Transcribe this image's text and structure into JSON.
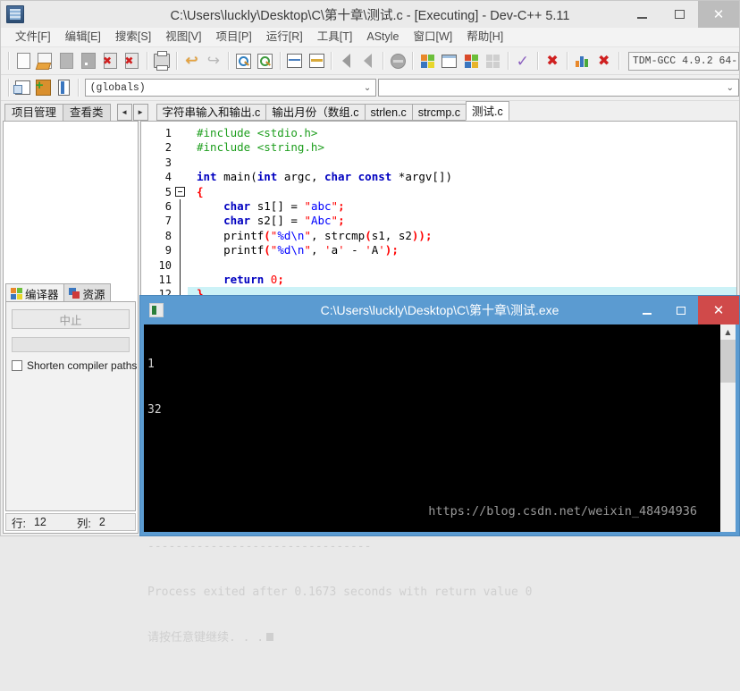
{
  "ide": {
    "title": "C:\\Users\\luckly\\Desktop\\C\\第十章\\测试.c - [Executing] - Dev-C++ 5.11",
    "window_controls": {
      "minimize": "–",
      "maximize": "□",
      "close": "✕"
    },
    "menu": [
      {
        "label": "文件[F]"
      },
      {
        "label": "编辑[E]"
      },
      {
        "label": "搜索[S]"
      },
      {
        "label": "视图[V]"
      },
      {
        "label": "项目[P]"
      },
      {
        "label": "运行[R]"
      },
      {
        "label": "工具[T]"
      },
      {
        "label": "AStyle"
      },
      {
        "label": "窗口[W]"
      },
      {
        "label": "帮助[H]"
      }
    ],
    "compiler_combo": "TDM-GCC 4.9.2 64-",
    "scope_combo": "(globals)",
    "scope_combo2": "",
    "left_tabs": [
      {
        "label": "项目管理",
        "active": true
      },
      {
        "label": "查看类",
        "active": false
      }
    ],
    "nav_buttons": {
      "prev": "◄",
      "next": "►"
    },
    "editor_tabs": [
      {
        "label": "字符串输入和输出.c",
        "active": false
      },
      {
        "label": "输出月份（数组.c",
        "active": false
      },
      {
        "label": "strlen.c",
        "active": false
      },
      {
        "label": "strcmp.c",
        "active": false
      },
      {
        "label": "测试.c",
        "active": true
      }
    ],
    "bottom_tabs": [
      {
        "label": "编译器",
        "active": true
      },
      {
        "label": "资源",
        "active": false
      }
    ],
    "abort_button": "中止",
    "shorten_paths_label": "Shorten compiler paths",
    "status": {
      "row_label": "行:",
      "row_value": "12",
      "col_label": "列:",
      "col_value": "2"
    }
  },
  "code": {
    "lines": [
      {
        "num": "1",
        "text": "#include <stdio.h>"
      },
      {
        "num": "2",
        "text": "#include <string.h>"
      },
      {
        "num": "3",
        "text": ""
      },
      {
        "num": "4",
        "text": "int main(int argc, char const *argv[])"
      },
      {
        "num": "5",
        "text": "{"
      },
      {
        "num": "6",
        "text": "    char s1[] = \"abc\";"
      },
      {
        "num": "7",
        "text": "    char s2[] = \"Abc\";"
      },
      {
        "num": "8",
        "text": "    printf(\"%d\\n\", strcmp(s1, s2));"
      },
      {
        "num": "9",
        "text": "    printf(\"%d\\n\", 'a' - 'A');"
      },
      {
        "num": "10",
        "text": ""
      },
      {
        "num": "11",
        "text": "    return 0;"
      },
      {
        "num": "12",
        "text": "}"
      }
    ]
  },
  "console": {
    "title": "C:\\Users\\luckly\\Desktop\\C\\第十章\\测试.exe",
    "window_controls": {
      "minimize": "–",
      "maximize": "□",
      "close": "✕"
    },
    "output_lines": [
      "1",
      "32",
      "",
      "",
      "--------------------------------",
      "Process exited after 0.1673 seconds with return value 0",
      "请按任意键继续. . ."
    ],
    "scroll_up_arrow": "▲"
  },
  "watermark": "https://blog.csdn.net/weixin_48494936",
  "colors": {
    "console_title_blue": "#5b9bd1",
    "close_red": "#d04a4a",
    "keyword_blue": "#0000c0",
    "string_blue": "#0000ff",
    "preproc_green": "#1d9e1d",
    "symbol_red": "#ff0000",
    "selection_cyan": "#ccf2f7"
  }
}
